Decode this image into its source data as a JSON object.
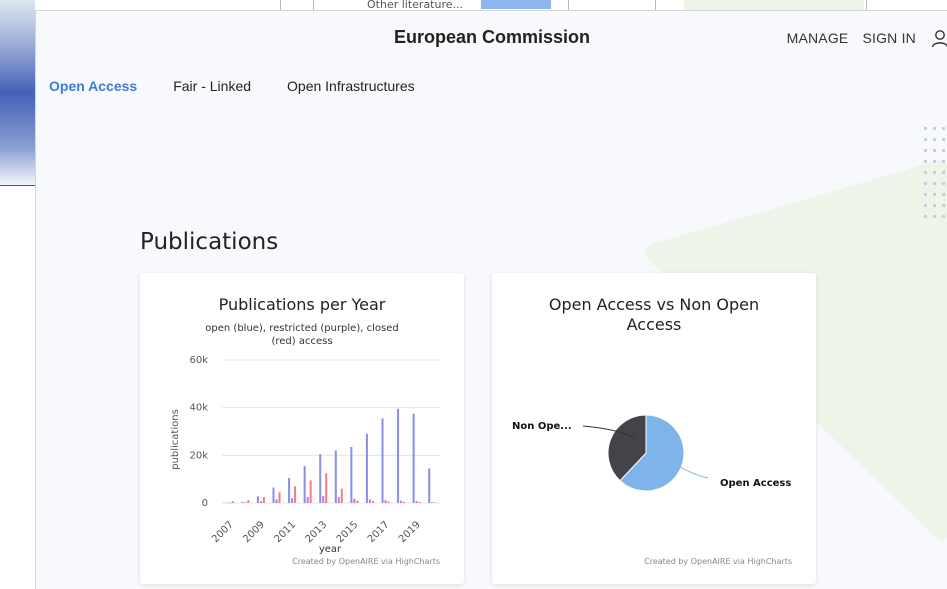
{
  "background": {
    "other_literature": "Other literature..."
  },
  "header": {
    "title": "European Commission",
    "manage": "MANAGE",
    "sign_in": "SIGN IN"
  },
  "tabs": [
    {
      "label": "Open Access",
      "active": true
    },
    {
      "label": "Fair - Linked",
      "active": false
    },
    {
      "label": "Open Infrastructures",
      "active": false
    }
  ],
  "section": {
    "title": "Publications"
  },
  "colors": {
    "open": "#8a8ee8",
    "restricted": "#c57ad9",
    "closed": "#f47a8a",
    "oa_pie": "#7eb3ec",
    "non_oa_pie": "#434348",
    "accent": "#3f7bd6"
  },
  "chart_data": [
    {
      "type": "bar",
      "title": "Publications per Year",
      "subtitle_line1": "open (blue), restricted (purple), closed",
      "subtitle_line2": "(red) access",
      "xlabel": "year",
      "ylabel": "publications",
      "credit": "Created by OpenAIRE via HighCharts",
      "ylim": [
        0,
        60000
      ],
      "yticks": [
        {
          "value": 0,
          "label": "0"
        },
        {
          "value": 20000,
          "label": "20k"
        },
        {
          "value": 40000,
          "label": "40k"
        },
        {
          "value": 60000,
          "label": "60k"
        }
      ],
      "x_tick_labels": [
        "2007",
        "2009",
        "2011",
        "2013",
        "2015",
        "2017",
        "2019"
      ],
      "categories": [
        "2007",
        "2008",
        "2009",
        "2010",
        "2011",
        "2012",
        "2013",
        "2014",
        "2015",
        "2016",
        "2017",
        "2018",
        "2019",
        "2020"
      ],
      "series": [
        {
          "name": "open",
          "values": [
            200,
            500,
            2800,
            6500,
            10500,
            15500,
            20500,
            22000,
            23500,
            29000,
            35500,
            39500,
            37500,
            14500
          ]
        },
        {
          "name": "restricted",
          "values": [
            100,
            300,
            800,
            1500,
            2000,
            2500,
            3000,
            2500,
            1800,
            1500,
            1200,
            1000,
            800,
            300
          ]
        },
        {
          "name": "closed",
          "values": [
            800,
            1200,
            2500,
            4500,
            7000,
            9500,
            12500,
            6000,
            1000,
            800,
            600,
            500,
            400,
            200
          ]
        }
      ]
    },
    {
      "type": "pie",
      "title_line1": "Open Access vs Non Open",
      "title_line2": "Access",
      "credit": "Created by OpenAIRE via HighCharts",
      "slices": [
        {
          "name": "Open Access",
          "value": 62
        },
        {
          "name": "Non Ope...",
          "value": 38
        }
      ]
    }
  ]
}
